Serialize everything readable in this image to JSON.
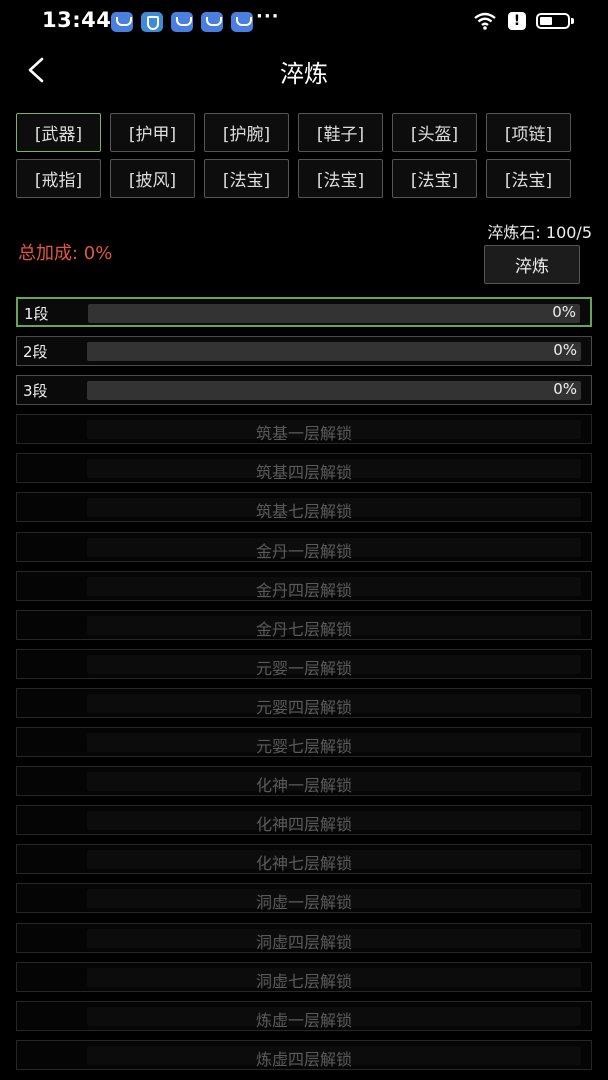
{
  "status_bar": {
    "time": "13:44",
    "more": "···",
    "alert": "!"
  },
  "header": {
    "title": "淬炼"
  },
  "tabs": [
    [
      "[武器]",
      "[护甲]",
      "[护腕]",
      "[鞋子]",
      "[头盔]",
      "[项链]"
    ],
    [
      "[戒指]",
      "[披风]",
      "[法宝]",
      "[法宝]",
      "[法宝]",
      "[法宝]"
    ]
  ],
  "active_tab": "[武器]",
  "stone": "淬炼石: 100/5",
  "total_bonus": "总加成: 0%",
  "refine_button": "淬炼",
  "stages": [
    {
      "label": "1段",
      "percent": "0%",
      "progress": 0
    },
    {
      "label": "2段",
      "percent": "0%",
      "progress": 0
    },
    {
      "label": "3段",
      "percent": "0%",
      "progress": 0
    }
  ],
  "locked": [
    "筑基一层解锁",
    "筑基四层解锁",
    "筑基七层解锁",
    "金丹一层解锁",
    "金丹四层解锁",
    "金丹七层解锁",
    "元婴一层解锁",
    "元婴四层解锁",
    "元婴七层解锁",
    "化神一层解锁",
    "化神四层解锁",
    "化神七层解锁",
    "洞虚一层解锁",
    "洞虚四层解锁",
    "洞虚七层解锁",
    "炼虚一层解锁",
    "炼虚四层解锁"
  ],
  "colors": {
    "accent_green": "#6ea25a",
    "bonus_red": "#e2563f"
  }
}
